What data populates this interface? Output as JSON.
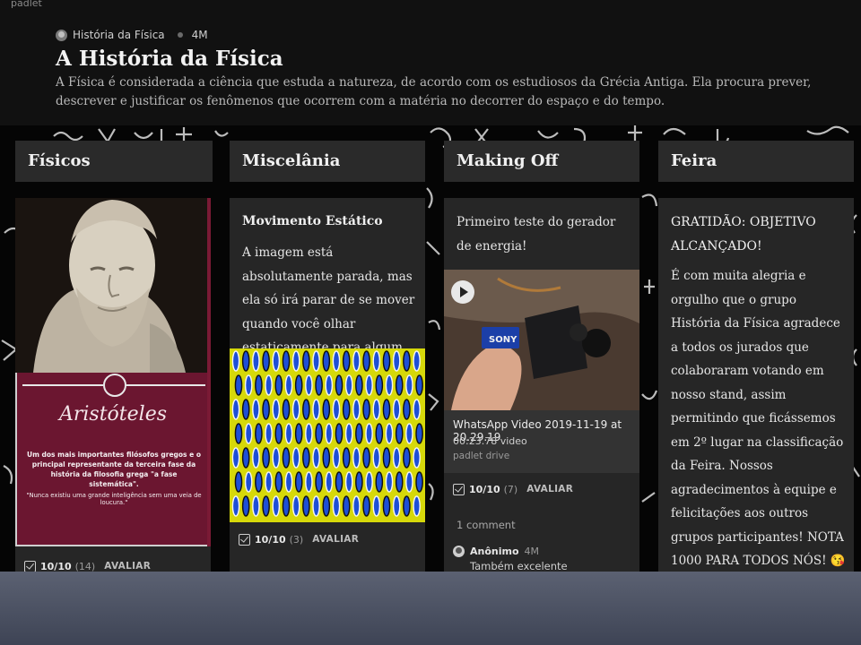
{
  "app": {
    "brand": "padlet"
  },
  "header": {
    "author": "História da Física",
    "age": "4M",
    "title": "A História da Física",
    "description": "A Física é considerada a ciência que estuda a natureza, de acordo com os estudiosos da Grécia Antiga. Ela procura prever, descrever e justificar os fenômenos que ocorrem com a matéria no decorrer do espaço e do tempo."
  },
  "columns": [
    {
      "title": "Físicos"
    },
    {
      "title": "Miscelânia"
    },
    {
      "title": "Making Off"
    },
    {
      "title": "Feira"
    }
  ],
  "fisicos_card": {
    "name": "Aristóteles",
    "text": "Um dos mais importantes filósofos gregos e o principal representante da terceira fase da história da filosofia grega \"a fase sistemática\".",
    "quote": "\"Nunca existiu uma grande inteligência sem uma veia de loucura.\"",
    "rating": "10/10",
    "count": "(14)",
    "rate_label": "AVALIAR"
  },
  "misc_card": {
    "title": "Movimento Estático",
    "body": "A imagem está absolutamente parada, mas ela só irá parar de se mover quando você olhar estaticamente para algum ponto.",
    "rating": "10/10",
    "count": "(3)",
    "rate_label": "AVALIAR"
  },
  "making_card": {
    "body": "Primeiro teste do gerador de energia!",
    "video_name": "WhatsApp Video 2019-11-19 at 20.29.19",
    "video_info": "00:23.78 video",
    "video_source": "padlet drive",
    "rating": "10/10",
    "count": "(7)",
    "rate_label": "AVALIAR",
    "comments": "1 comment",
    "comment_author": "Anônimo",
    "comment_time": "4M",
    "comment_text": "Também excelente"
  },
  "feira_card": {
    "title": "GRATIDÃO: OBJETIVO ALCANÇADO!",
    "body": "É com muita alegria e orgulho que o grupo História da Física agradece a todos os jurados que colaboraram votando em nosso stand, assim permitindo que ficássemos em 2º lugar na classificação da Feira. Nossos agradecimentos à equipe e felicitações aos outros grupos participantes! NOTA 1000 PARA TODOS NÓS! 😘"
  },
  "colors": {
    "card_bg": "#262626",
    "column_header_bg": "#2a2a2a",
    "aristoteles_panel": "#6b1630",
    "illusion_bg": "#d6d80a",
    "bottom_bar": "#5b6172"
  }
}
